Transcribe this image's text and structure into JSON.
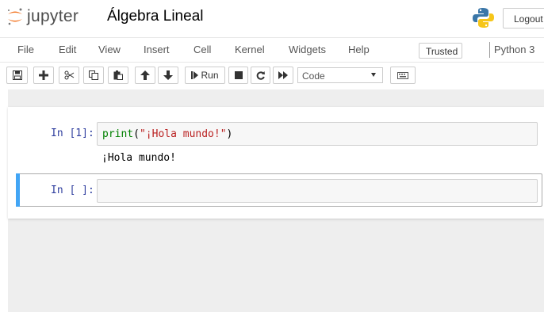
{
  "header": {
    "logo_text": "jupyter",
    "notebook_title": "Álgebra Lineal",
    "logout_label": "Logout",
    "logo_icon": "jupyter-logo-icon",
    "kernel_logo_icon": "python-logo-icon"
  },
  "menubar": {
    "items": [
      "File",
      "Edit",
      "View",
      "Insert",
      "Cell",
      "Kernel",
      "Widgets",
      "Help"
    ],
    "trusted_label": "Trusted",
    "kernel_name": "Python 3"
  },
  "toolbar": {
    "buttons": [
      {
        "name": "save-button",
        "icon": "floppy-disk-icon"
      },
      {
        "name": "insert-cell-below-button",
        "icon": "plus-icon"
      },
      {
        "name": "cut-cells-button",
        "icon": "scissors-icon"
      },
      {
        "name": "copy-cells-button",
        "icon": "copy-icon"
      },
      {
        "name": "paste-cells-button",
        "icon": "paste-icon"
      },
      {
        "name": "move-cells-up-button",
        "icon": "arrow-up-icon"
      },
      {
        "name": "move-cells-down-button",
        "icon": "arrow-down-icon"
      },
      {
        "name": "run-button",
        "icon": "step-forward-icon"
      },
      {
        "name": "interrupt-kernel-button",
        "icon": "stop-icon"
      },
      {
        "name": "restart-kernel-button",
        "icon": "restart-icon"
      },
      {
        "name": "restart-run-all-button",
        "icon": "fast-forward-icon"
      },
      {
        "name": "command-palette-button",
        "icon": "keyboard-icon"
      }
    ],
    "run_label": "Run",
    "cell_type_selected": "Code"
  },
  "cells": [
    {
      "prompt": "In [1]:",
      "code": {
        "builtin": "print",
        "open": "(",
        "string": "\"¡Hola mundo!\"",
        "close": ")"
      },
      "output": "¡Hola mundo!"
    },
    {
      "prompt": "In [ ]:",
      "code": ""
    }
  ],
  "colors": {
    "prompt": "#303f9f",
    "selected_cell_bar": "#42a5f5",
    "builtin": "#008000",
    "string": "#ba2121",
    "jupyter_orange": "#f37726"
  }
}
